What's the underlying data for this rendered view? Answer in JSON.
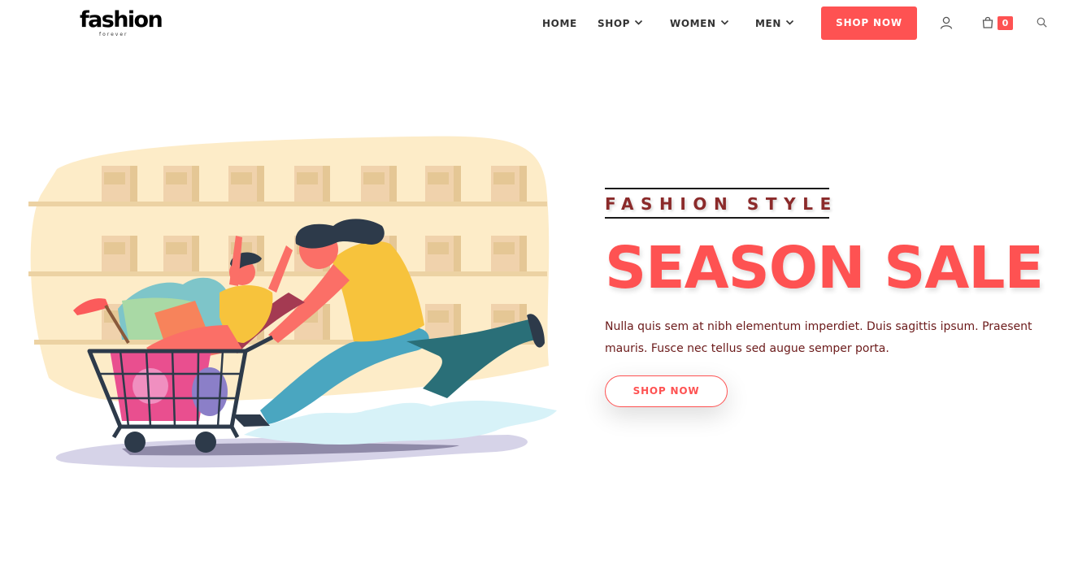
{
  "brand": {
    "logo_text": "fashion",
    "logo_tagline": "forever"
  },
  "nav": {
    "home": "HOME",
    "shop": "SHOP",
    "women": "WOMEN",
    "men": "MEN",
    "cta": "SHOP NOW",
    "cart_count": "0",
    "icons": [
      "user-icon",
      "shopping-bag-icon",
      "search-icon",
      "chevron-down-icon"
    ]
  },
  "hero": {
    "kicker": "FASHION STYLE",
    "headline": "SEASON SALE",
    "copy": "Nulla quis sem at nibh elementum imperdiet. Duis sagittis ipsum. Praesent mauris. Fusce nec tellus sed augue semper porta.",
    "cta": "SHOP NOW"
  },
  "colors": {
    "accent": "#fe5252",
    "kicker_text": "#8b2a2a",
    "body_text": "#6b1a1a",
    "backdrop": "#fdecc8"
  }
}
